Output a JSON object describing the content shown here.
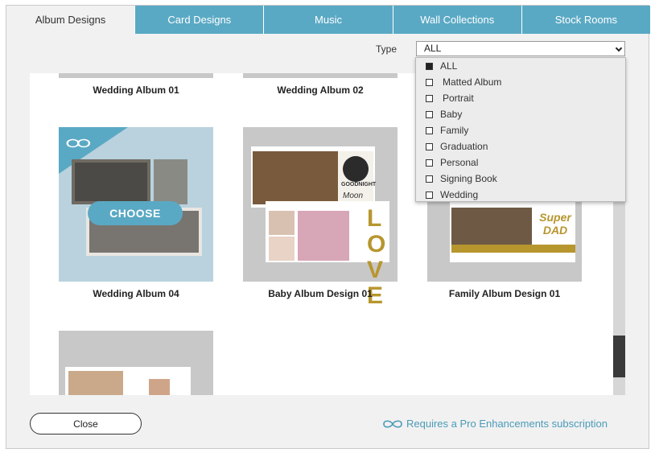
{
  "tabs": [
    {
      "label": "Album Designs"
    },
    {
      "label": "Card Designs"
    },
    {
      "label": "Music"
    },
    {
      "label": "Wall Collections"
    },
    {
      "label": "Stock Rooms"
    }
  ],
  "filter": {
    "label": "Type",
    "selected": "ALL"
  },
  "dropdown": {
    "options": [
      {
        "label": "ALL",
        "checked": true
      },
      {
        "label": "Matted Album",
        "checked": false
      },
      {
        "label": "Portrait",
        "checked": false
      },
      {
        "label": "Baby",
        "checked": false
      },
      {
        "label": "Family",
        "checked": false
      },
      {
        "label": "Graduation",
        "checked": false
      },
      {
        "label": "Personal",
        "checked": false
      },
      {
        "label": "Signing Book",
        "checked": false
      },
      {
        "label": "Wedding",
        "checked": false
      }
    ]
  },
  "cards": [
    {
      "title": "Wedding Album 01"
    },
    {
      "title": "Wedding Album 02"
    },
    {
      "title": "Wedding Album 04"
    },
    {
      "title": "Baby Album Design 01"
    },
    {
      "title": "Family Album Design 01"
    }
  ],
  "card_overlay": {
    "choose_label": "CHOOSE",
    "baby_text_top": "GOODNIGHT",
    "baby_text_moon": "Moon",
    "love_letters": "LOVE",
    "family_text": "Super DAD"
  },
  "footer": {
    "close_label": "Close",
    "pro_text": "Requires a Pro Enhancements subscription"
  },
  "colors": {
    "accent": "#5aa9c4",
    "pro_text": "#4a9bb8"
  },
  "icons": {
    "infinity": "infinity-icon",
    "chevron": "chevron-down-icon"
  }
}
